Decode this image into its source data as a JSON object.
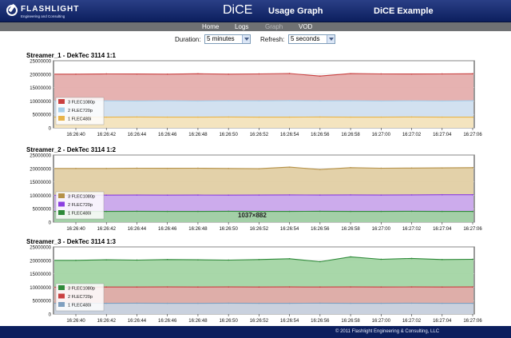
{
  "header": {
    "logo_word": "FLASHLIGHT",
    "logo_sub": "Engineering and Consulting",
    "app_title": "DiCE",
    "page_title": "Usage Graph",
    "right_title": "DiCE Example"
  },
  "nav": {
    "items": [
      {
        "label": "Home",
        "active": false
      },
      {
        "label": "Logs",
        "active": false
      },
      {
        "label": "Graph",
        "active": true
      },
      {
        "label": "VOD",
        "active": false
      }
    ]
  },
  "controls": {
    "duration_label": "Duration:",
    "duration_value": "5 minutes",
    "refresh_label": "Refresh:",
    "refresh_value": "5 seconds"
  },
  "colors": {
    "header_bg": "#0c1f5e",
    "nav_bg": "#6f7173",
    "red": "#c94040",
    "red_fill": "#e3aaa9",
    "lightblue": "#a6cfea",
    "lightblue_fill": "#cfe6f7",
    "yellow": "#e8b44a",
    "yellow_fill": "#f7e4b9",
    "tan": "#b59148",
    "tan_fill": "#e0cca0",
    "purple": "#8b3fe0",
    "purple_fill": "#c9a6f3",
    "green": "#2f8a3a",
    "green_fill": "#9fd3a0",
    "steel": "#7f9fbf",
    "steel_fill": "#c7d5e3"
  },
  "chart_data": [
    {
      "type": "area",
      "title": "Streamer_1 - DekTec 3114 1:1",
      "x": [
        "16:26:40",
        "16:26:42",
        "16:26:44",
        "16:26:46",
        "16:26:48",
        "16:26:50",
        "16:26:52",
        "16:26:54",
        "16:26:56",
        "16:26:58",
        "16:27:00",
        "16:27:02",
        "16:27:04",
        "16:27:06"
      ],
      "ylim": [
        0,
        25000000
      ],
      "yticks": [
        "25000000",
        "20000000",
        "15000000",
        "10000000",
        "5000000",
        "0"
      ],
      "grid": true,
      "legend_position": "bottom-left",
      "series": [
        {
          "name": "3 FLEC1080p",
          "color": "red",
          "values": [
            20000000,
            20100000,
            20050000,
            20000000,
            20150000,
            20000000,
            20100000,
            20250000,
            19300000,
            20200000,
            20100000,
            20050000,
            20100000,
            20150000
          ]
        },
        {
          "name": "2 FLEC720p",
          "color": "lightblue",
          "values": [
            10000000,
            10050000,
            10000000,
            10100000,
            10000000,
            10100000,
            10050000,
            10150000,
            10050000,
            10100000,
            10000000,
            10050000,
            10000000,
            10100000
          ]
        },
        {
          "name": "1 FLEC480i",
          "color": "yellow",
          "values": [
            4000000,
            4000000,
            4050000,
            4000000,
            4000000,
            4050000,
            4000000,
            4000000,
            4050000,
            4000000,
            4000000,
            4050000,
            4000000,
            4000000
          ]
        }
      ]
    },
    {
      "type": "area",
      "title": "Streamer_2 - DekTec 3114 1:2",
      "x": [
        "16:26:40",
        "16:26:42",
        "16:26:44",
        "16:26:46",
        "16:26:48",
        "16:26:50",
        "16:26:52",
        "16:26:54",
        "16:26:56",
        "16:26:58",
        "16:27:00",
        "16:27:02",
        "16:27:04",
        "16:27:06"
      ],
      "ylim": [
        0,
        25000000
      ],
      "yticks": [
        "25000000",
        "20000000",
        "15000000",
        "10000000",
        "5000000",
        "0"
      ],
      "grid": true,
      "legend_position": "bottom-left",
      "series": [
        {
          "name": "3 FLEC1080p",
          "color": "tan",
          "values": [
            20000000,
            20000000,
            20100000,
            20050000,
            20100000,
            20000000,
            19900000,
            20500000,
            19600000,
            20300000,
            20100000,
            20150000,
            20200000,
            20300000
          ]
        },
        {
          "name": "2 FLEC720p",
          "color": "purple",
          "values": [
            10000000,
            10050000,
            10100000,
            10050000,
            10100000,
            10050000,
            10100000,
            10150000,
            10100000,
            10150000,
            10100000,
            10150000,
            10200000,
            10200000
          ]
        },
        {
          "name": "1 FLEC480i",
          "color": "green",
          "values": [
            4000000,
            4000000,
            4050000,
            4000000,
            4000000,
            4050000,
            4000000,
            4000000,
            4050000,
            4000000,
            4000000,
            4050000,
            4000000,
            4000000
          ]
        }
      ]
    },
    {
      "type": "area",
      "title": "Streamer_3 - DekTec 3114 1:3",
      "x": [
        "16:26:40",
        "16:26:42",
        "16:26:44",
        "16:26:46",
        "16:26:48",
        "16:26:50",
        "16:26:52",
        "16:26:54",
        "16:26:56",
        "16:26:58",
        "16:27:00",
        "16:27:02",
        "16:27:04",
        "16:27:06"
      ],
      "ylim": [
        0,
        25000000
      ],
      "yticks": [
        "25000000",
        "20000000",
        "15000000",
        "10000000",
        "5000000",
        "0"
      ],
      "grid": true,
      "legend_position": "bottom-left",
      "series": [
        {
          "name": "3 FLEC1080p",
          "color": "green",
          "values": [
            20000000,
            20200000,
            20100000,
            20300000,
            20200000,
            20100000,
            20300000,
            20600000,
            19500000,
            21300000,
            20400000,
            20700000,
            20300000,
            20400000
          ]
        },
        {
          "name": "2 FLEC720p",
          "color": "red",
          "values": [
            10000000,
            10050000,
            10050000,
            10100000,
            10050000,
            10100000,
            10050000,
            10100000,
            10050000,
            10100000,
            10050000,
            10100000,
            10050000,
            10100000
          ]
        },
        {
          "name": "1 FLEC480i",
          "color": "steel",
          "values": [
            4000000,
            4000000,
            4050000,
            4000000,
            4000000,
            4050000,
            4000000,
            4000000,
            4050000,
            4000000,
            4000000,
            4050000,
            4000000,
            4000000
          ]
        }
      ]
    }
  ],
  "overlay": {
    "label": "1037×882"
  },
  "footer": {
    "copyright": "© 2011 Flashlight Engineering & Consulting, LLC"
  }
}
